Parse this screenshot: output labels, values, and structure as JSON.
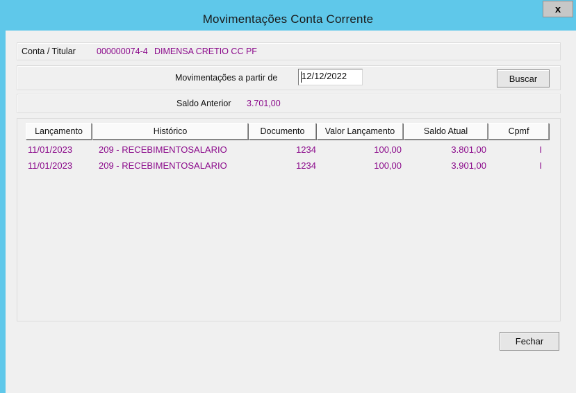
{
  "window": {
    "title": "Movimentações Conta Corrente",
    "close_label": "x"
  },
  "account": {
    "label": "Conta / Titular",
    "number": "000000074-4",
    "holder": "DIMENSA CRETIO CC PF"
  },
  "filter": {
    "label": "Movimentações a partir de",
    "date_value": "12/12/2022",
    "search_button": "Buscar"
  },
  "balance": {
    "label": "Saldo Anterior",
    "value": "3.701,00"
  },
  "table": {
    "headers": [
      "Lançamento",
      "Histórico",
      "Documento",
      "Valor Lançamento",
      "Saldo Atual",
      "Cpmf"
    ],
    "rows": [
      {
        "lancamento": "11/01/2023",
        "historico": "209 - RECEBIMENTOSALARIO",
        "documento": "1234",
        "valor": "100,00",
        "saldo": "3.801,00",
        "cpmf": "I"
      },
      {
        "lancamento": "11/01/2023",
        "historico": "209 - RECEBIMENTOSALARIO",
        "documento": "1234",
        "valor": "100,00",
        "saldo": "3.901,00",
        "cpmf": "I"
      }
    ]
  },
  "footer": {
    "close_button": "Fechar"
  },
  "colors": {
    "titlebar": "#5fc8ea",
    "data_text": "#8b0a8b",
    "background": "#f0f0f0"
  }
}
